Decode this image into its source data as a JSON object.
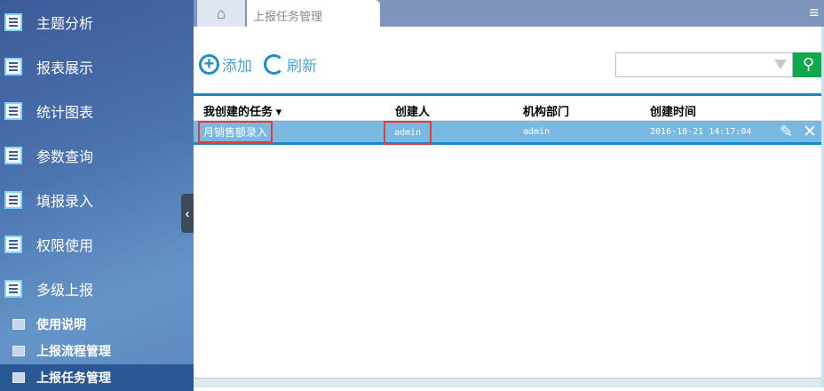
{
  "sidebar": {
    "items": [
      {
        "label": "主题分析",
        "icon": "report-icon"
      },
      {
        "label": "报表展示",
        "icon": "report-icon"
      },
      {
        "label": "统计图表",
        "icon": "report-icon"
      },
      {
        "label": "参数查询",
        "icon": "report-icon"
      },
      {
        "label": "填报录入",
        "icon": "report-icon"
      },
      {
        "label": "权限使用",
        "icon": "report-icon"
      },
      {
        "label": "多级上报",
        "icon": "report-icon"
      }
    ],
    "subitems": [
      {
        "label": "使用说明",
        "icon": "chart-icon"
      },
      {
        "label": "上报流程管理",
        "icon": "table-icon"
      },
      {
        "label": "上报任务管理",
        "icon": "table-icon",
        "active": true
      }
    ],
    "collapse": "‹"
  },
  "tabs": {
    "home": "⌂",
    "active": "上报任务管理",
    "menu": "≡"
  },
  "toolbar": {
    "add": "添加",
    "refresh": "刷新",
    "search_value": ""
  },
  "table": {
    "headers": [
      "我创建的任务",
      "创建人",
      "机构部门",
      "创建时间"
    ],
    "sort_indicator": "▾",
    "rows": [
      {
        "task": "月销售额录入",
        "creator": "admin",
        "dept": "admin",
        "time": "2016-10-21 14:17:04"
      }
    ]
  },
  "colors": {
    "accent": "#1b86c8",
    "row_selected": "#79b8e0",
    "search_button": "#10a84a",
    "highlight": "#e63a3a"
  }
}
